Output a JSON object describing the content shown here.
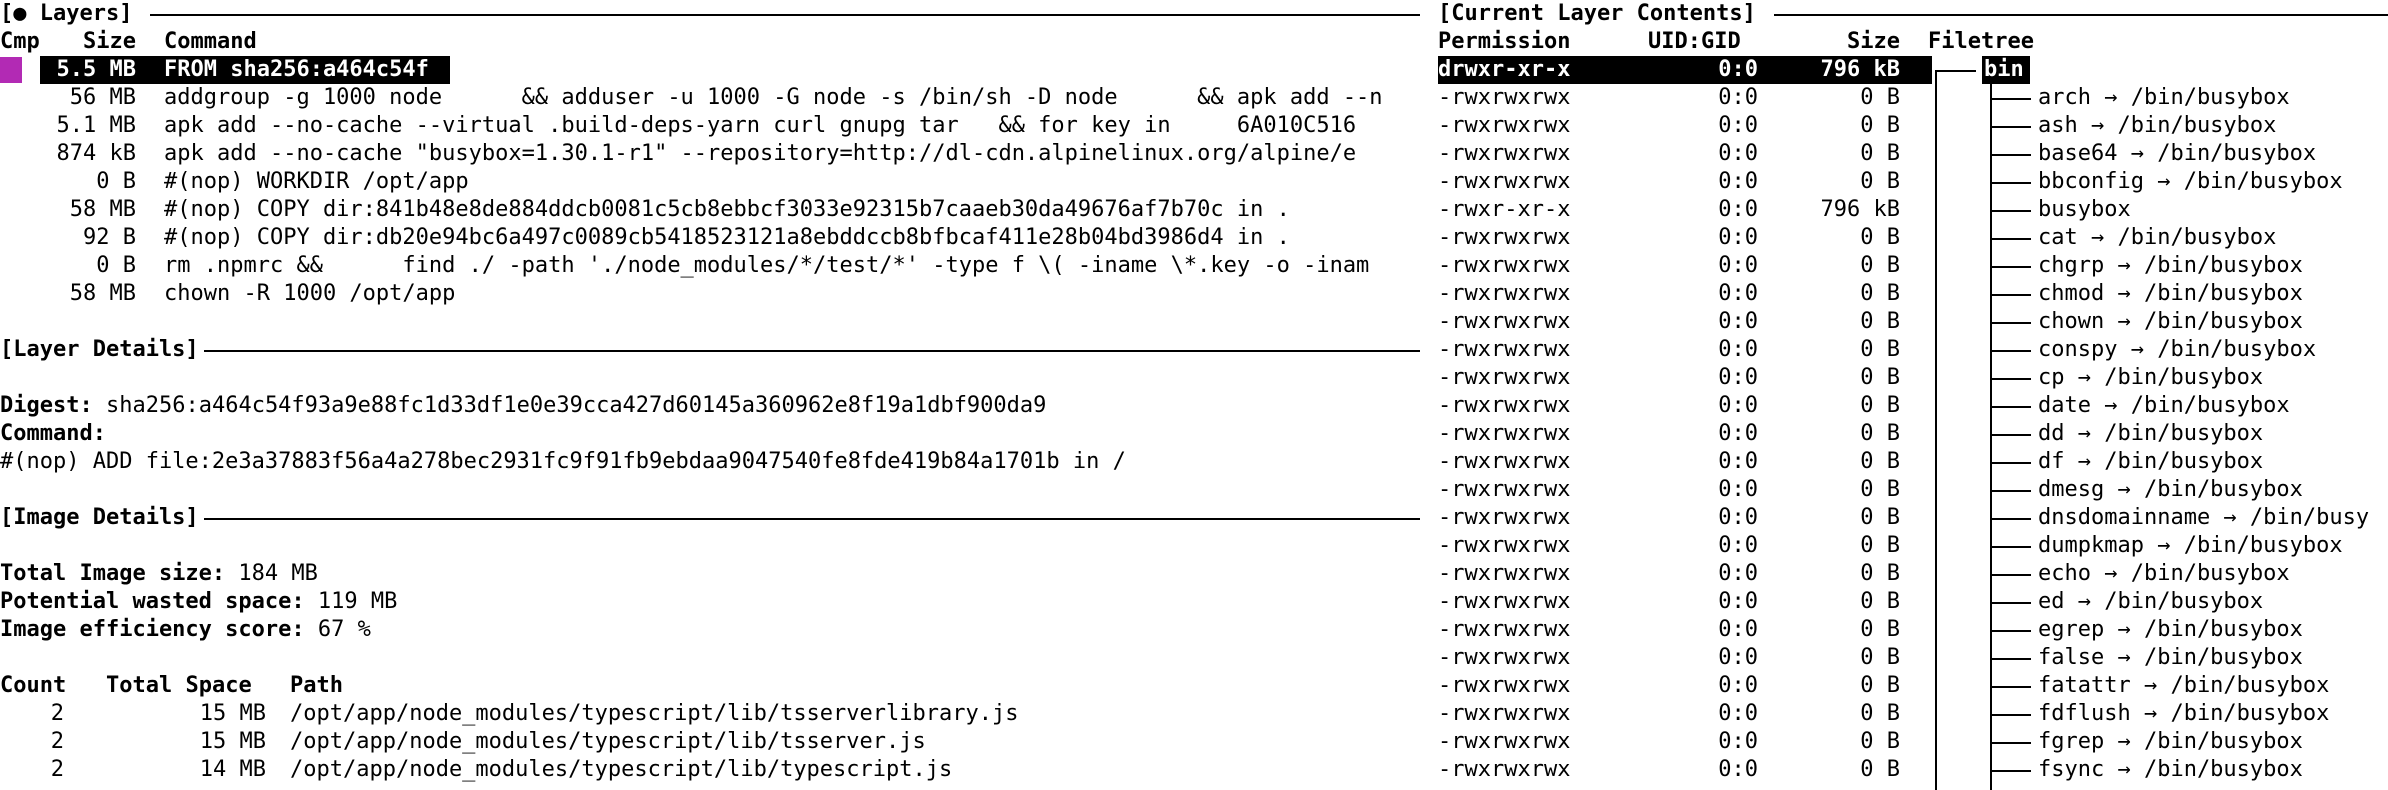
{
  "colors": {
    "cmp_marker": "#b22ab4",
    "selection_bg": "#000000",
    "selection_fg": "#ffffff"
  },
  "layers_panel": {
    "title": "[● Layers]",
    "headers": {
      "cmp": "Cmp",
      "size": "Size",
      "command": "Command"
    },
    "rows": [
      {
        "size": "5.5 MB",
        "command": "FROM sha256:a464c54f",
        "selected": true
      },
      {
        "size": "56 MB",
        "command": "addgroup -g 1000 node      && adduser -u 1000 -G node -s /bin/sh -D node      && apk add --n"
      },
      {
        "size": "5.1 MB",
        "command": "apk add --no-cache --virtual .build-deps-yarn curl gnupg tar   && for key in     6A010C516"
      },
      {
        "size": "874 kB",
        "command": "apk add --no-cache \"busybox=1.30.1-r1\" --repository=http://dl-cdn.alpinelinux.org/alpine/e"
      },
      {
        "size": "0 B",
        "command": "#(nop) WORKDIR /opt/app"
      },
      {
        "size": "58 MB",
        "command": "#(nop) COPY dir:841b48e8de884ddcb0081c5cb8ebbcf3033e92315b7caaeb30da49676af7b70c in ."
      },
      {
        "size": "92 B",
        "command": "#(nop) COPY dir:db20e94bc6a497c0089cb5418523121a8ebddccb8bfbcaf411e28b04bd3986d4 in ."
      },
      {
        "size": "0 B",
        "command": "rm .npmrc &&      find ./ -path './node_modules/*/test/*' -type f \\( -iname \\*.key -o -inam"
      },
      {
        "size": "58 MB",
        "command": "chown -R 1000 /opt/app"
      }
    ]
  },
  "layer_details": {
    "title": "[Layer Details]",
    "digest_label": "Digest:",
    "digest_value": "sha256:a464c54f93a9e88fc1d33df1e0e39cca427d60145a360962e8f19a1dbf900da9",
    "command_label": "Command:",
    "command_value": "#(nop) ADD file:2e3a37883f56a4a278bec2931fc9f91fb9ebdaa9047540fe8fde419b84a1701b in /"
  },
  "image_details": {
    "title": "[Image Details]",
    "total_size_label": "Total Image size:",
    "total_size_value": "184 MB",
    "wasted_label": "Potential wasted space:",
    "wasted_value": "119 MB",
    "efficiency_label": "Image efficiency score:",
    "efficiency_value": "67 %",
    "table_headers": {
      "count": "Count",
      "total_space": "Total Space",
      "path": "Path"
    },
    "rows": [
      {
        "count": "2",
        "space": "15 MB",
        "path": "/opt/app/node_modules/typescript/lib/tsserverlibrary.js"
      },
      {
        "count": "2",
        "space": "15 MB",
        "path": "/opt/app/node_modules/typescript/lib/tsserver.js"
      },
      {
        "count": "2",
        "space": "14 MB",
        "path": "/opt/app/node_modules/typescript/lib/typescript.js"
      }
    ]
  },
  "contents_panel": {
    "title": "[Current Layer Contents]",
    "headers": {
      "permission": "Permission",
      "uidgid": "UID:GID",
      "size": "Size",
      "filetree": "Filetree"
    },
    "rows": [
      {
        "perm": "drwxr-xr-x",
        "uid": "0:0",
        "size": "796 kB",
        "name": "bin",
        "selected": true
      },
      {
        "perm": "-rwxrwxrwx",
        "uid": "0:0",
        "size": "0 B",
        "name": "arch → /bin/busybox"
      },
      {
        "perm": "-rwxrwxrwx",
        "uid": "0:0",
        "size": "0 B",
        "name": "ash → /bin/busybox"
      },
      {
        "perm": "-rwxrwxrwx",
        "uid": "0:0",
        "size": "0 B",
        "name": "base64 → /bin/busybox"
      },
      {
        "perm": "-rwxrwxrwx",
        "uid": "0:0",
        "size": "0 B",
        "name": "bbconfig → /bin/busybox"
      },
      {
        "perm": "-rwxr-xr-x",
        "uid": "0:0",
        "size": "796 kB",
        "name": "busybox"
      },
      {
        "perm": "-rwxrwxrwx",
        "uid": "0:0",
        "size": "0 B",
        "name": "cat → /bin/busybox"
      },
      {
        "perm": "-rwxrwxrwx",
        "uid": "0:0",
        "size": "0 B",
        "name": "chgrp → /bin/busybox"
      },
      {
        "perm": "-rwxrwxrwx",
        "uid": "0:0",
        "size": "0 B",
        "name": "chmod → /bin/busybox"
      },
      {
        "perm": "-rwxrwxrwx",
        "uid": "0:0",
        "size": "0 B",
        "name": "chown → /bin/busybox"
      },
      {
        "perm": "-rwxrwxrwx",
        "uid": "0:0",
        "size": "0 B",
        "name": "conspy → /bin/busybox"
      },
      {
        "perm": "-rwxrwxrwx",
        "uid": "0:0",
        "size": "0 B",
        "name": "cp → /bin/busybox"
      },
      {
        "perm": "-rwxrwxrwx",
        "uid": "0:0",
        "size": "0 B",
        "name": "date → /bin/busybox"
      },
      {
        "perm": "-rwxrwxrwx",
        "uid": "0:0",
        "size": "0 B",
        "name": "dd → /bin/busybox"
      },
      {
        "perm": "-rwxrwxrwx",
        "uid": "0:0",
        "size": "0 B",
        "name": "df → /bin/busybox"
      },
      {
        "perm": "-rwxrwxrwx",
        "uid": "0:0",
        "size": "0 B",
        "name": "dmesg → /bin/busybox"
      },
      {
        "perm": "-rwxrwxrwx",
        "uid": "0:0",
        "size": "0 B",
        "name": "dnsdomainname → /bin/busy"
      },
      {
        "perm": "-rwxrwxrwx",
        "uid": "0:0",
        "size": "0 B",
        "name": "dumpkmap → /bin/busybox"
      },
      {
        "perm": "-rwxrwxrwx",
        "uid": "0:0",
        "size": "0 B",
        "name": "echo → /bin/busybox"
      },
      {
        "perm": "-rwxrwxrwx",
        "uid": "0:0",
        "size": "0 B",
        "name": "ed → /bin/busybox"
      },
      {
        "perm": "-rwxrwxrwx",
        "uid": "0:0",
        "size": "0 B",
        "name": "egrep → /bin/busybox"
      },
      {
        "perm": "-rwxrwxrwx",
        "uid": "0:0",
        "size": "0 B",
        "name": "false → /bin/busybox"
      },
      {
        "perm": "-rwxrwxrwx",
        "uid": "0:0",
        "size": "0 B",
        "name": "fatattr → /bin/busybox"
      },
      {
        "perm": "-rwxrwxrwx",
        "uid": "0:0",
        "size": "0 B",
        "name": "fdflush → /bin/busybox"
      },
      {
        "perm": "-rwxrwxrwx",
        "uid": "0:0",
        "size": "0 B",
        "name": "fgrep → /bin/busybox"
      },
      {
        "perm": "-rwxrwxrwx",
        "uid": "0:0",
        "size": "0 B",
        "name": "fsync → /bin/busybox"
      }
    ]
  }
}
